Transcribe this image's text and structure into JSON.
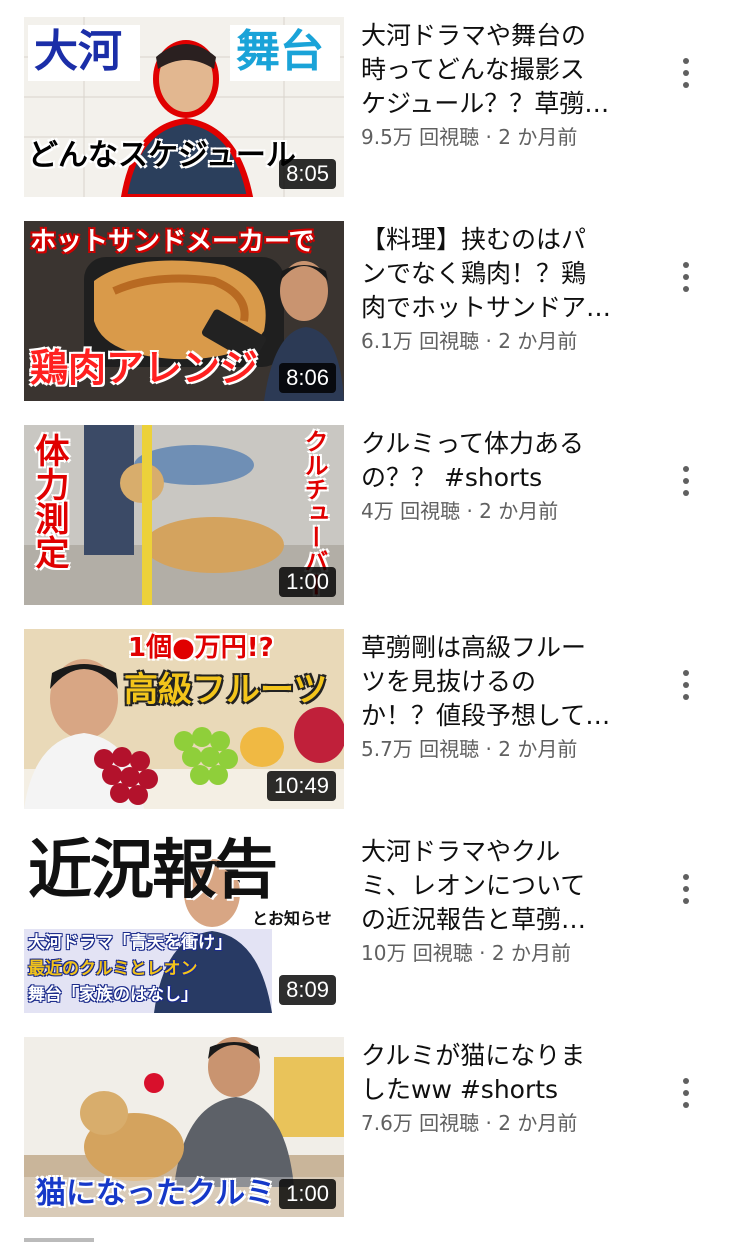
{
  "videos": [
    {
      "title_lines": [
        "大河ドラマや舞台の",
        "時ってどんな撮影ス",
        "ケジュール？？草彅…"
      ],
      "meta": "9.5万 回視聴 · 2 か月前",
      "duration": "8:05",
      "captions": [
        "大河",
        "舞台",
        "どんなスケジュール"
      ]
    },
    {
      "title_lines": [
        "【料理】挟むのはパ",
        "ンでなく鶏肉！？鶏",
        "肉でホットサンドア…"
      ],
      "meta": "6.1万 回視聴 · 2 か月前",
      "duration": "8:06",
      "captions": [
        "ホットサンドメーカーで",
        "鶏肉アレンジ"
      ]
    },
    {
      "title_lines": [
        "クルミって体力ある",
        "の？？ #shorts"
      ],
      "meta": "4万 回視聴 · 2 か月前",
      "duration": "1:00",
      "captions": [
        "体力測定",
        "クルチューバー"
      ]
    },
    {
      "title_lines": [
        "草彅剛は高級フルー",
        "ツを見抜けるの",
        "か！？値段予想して…"
      ],
      "meta": "5.7万 回視聴 · 2 か月前",
      "duration": "10:49",
      "captions": [
        "1個●万円!?",
        "高級フルーツ"
      ]
    },
    {
      "title_lines": [
        "大河ドラマやクル",
        "ミ、レオンについて",
        "の近況報告と草彅…"
      ],
      "meta": "10万 回視聴 · 2 か月前",
      "duration": "8:09",
      "captions": [
        "近況報告",
        "とお知らせ",
        "大河ドラマ「青天を衝け」",
        "最近のクルミとレオン",
        "舞台「家族のはなし」"
      ]
    },
    {
      "title_lines": [
        "クルミが猫になりま",
        "したww #shorts"
      ],
      "meta": "7.6万 回視聴 · 2 か月前",
      "duration": "1:00",
      "captions": [
        "猫になったクルミ"
      ]
    }
  ],
  "icons": {
    "more": "more-vert-icon"
  },
  "colors": {
    "title": "#0f0f0f",
    "meta": "#606060",
    "duration_bg": "#000000"
  }
}
